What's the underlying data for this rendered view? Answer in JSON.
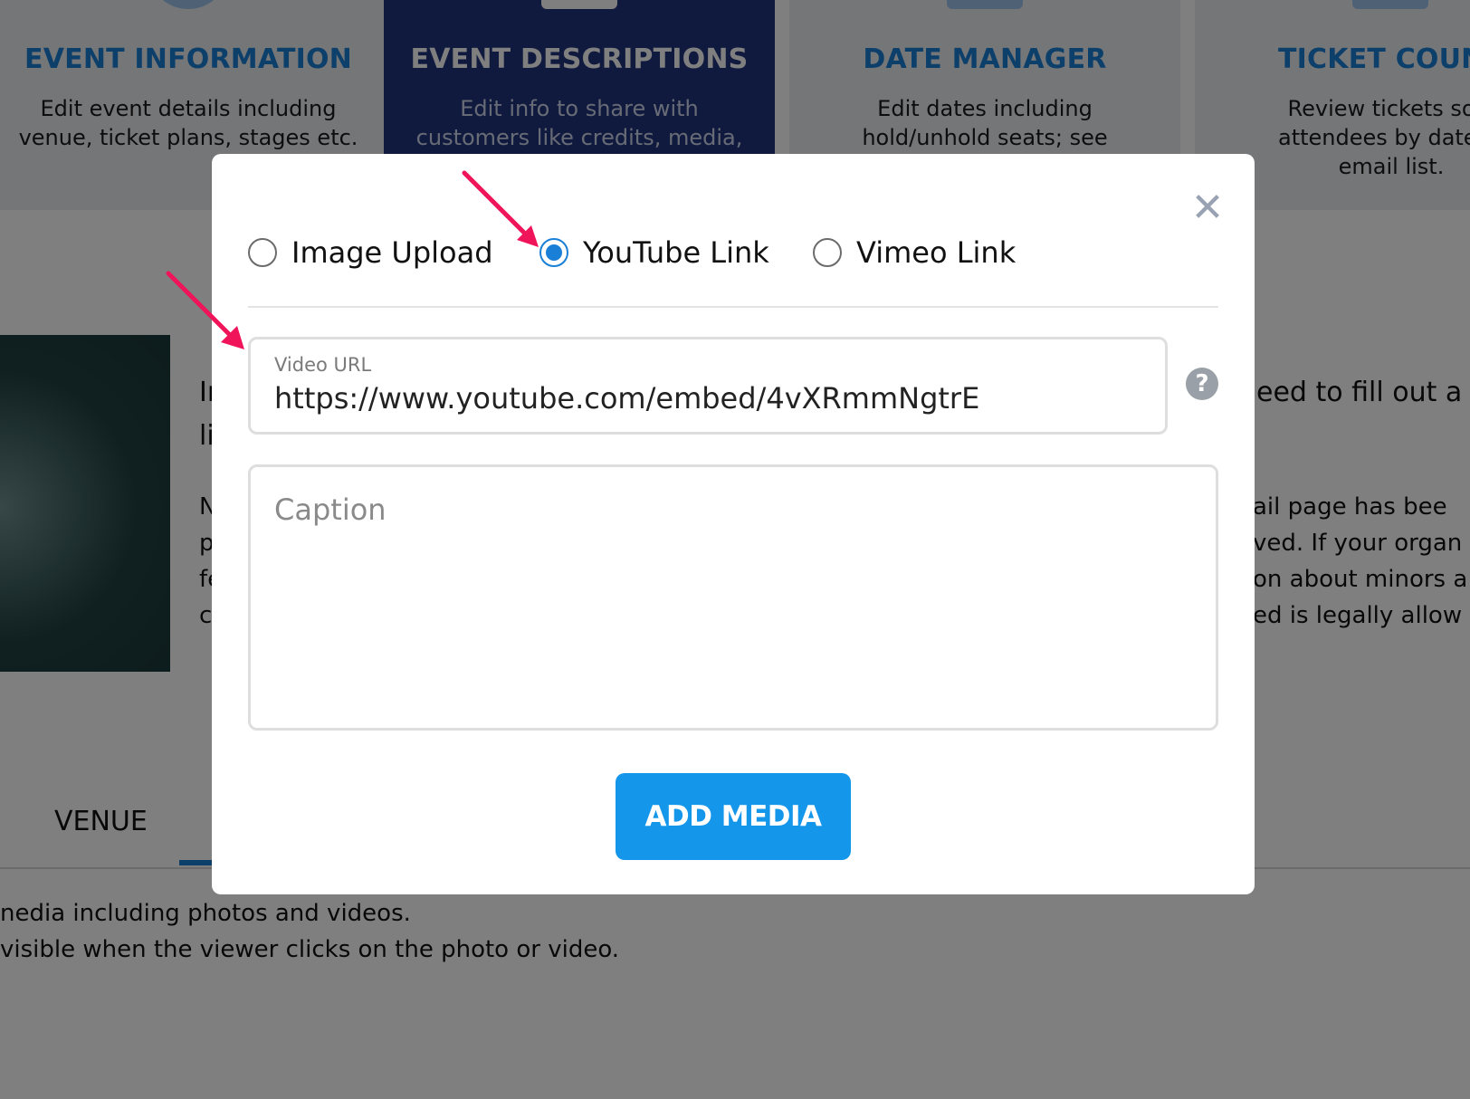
{
  "colors": {
    "accent": "#1496ea",
    "brand_blue": "#1a7fd6",
    "active_card": "#21347f",
    "annotation_arrow": "#f0145a"
  },
  "cards": [
    {
      "title": "EVENT INFORMATION",
      "desc_line1": "Edit event details including",
      "desc_line2": "venue, ticket plans, stages etc."
    },
    {
      "title": "EVENT DESCRIPTIONS",
      "desc_line1": "Edit info to share with",
      "desc_line2": "customers like credits, media,"
    },
    {
      "title": "DATE MANAGER",
      "desc_line1": "Edit dates including",
      "desc_line2": "hold/unhold seats; see"
    },
    {
      "title": "TICKET COUN",
      "desc_line1": "Review tickets sold",
      "desc_line2": "attendees by date; a",
      "desc_line3": "email list."
    }
  ],
  "background": {
    "left_text_line1": "Ir",
    "left_text_line2": "li",
    "left_para": [
      "N",
      "p",
      "fe",
      "c"
    ],
    "right_text": "eed to fill out a",
    "right_para": [
      "ail page has bee",
      "ved. If your organ",
      "on about minors a",
      "ed is legally allow"
    ],
    "venue_tab": "VENUE",
    "bottom_line1": "nedia including photos and videos.",
    "bottom_line2": "visible when the viewer clicks on the photo or video."
  },
  "modal": {
    "close_icon": "close-icon",
    "media_types": [
      {
        "label": "Image Upload",
        "checked": false
      },
      {
        "label": "YouTube Link",
        "checked": true
      },
      {
        "label": "Vimeo Link",
        "checked": false
      }
    ],
    "video_url": {
      "label": "Video URL",
      "value": "https://www.youtube.com/embed/4vXRmmNgtrE"
    },
    "help_icon": "question-circle-icon",
    "caption": {
      "placeholder": "Caption",
      "value": ""
    },
    "submit_label": "ADD MEDIA"
  }
}
